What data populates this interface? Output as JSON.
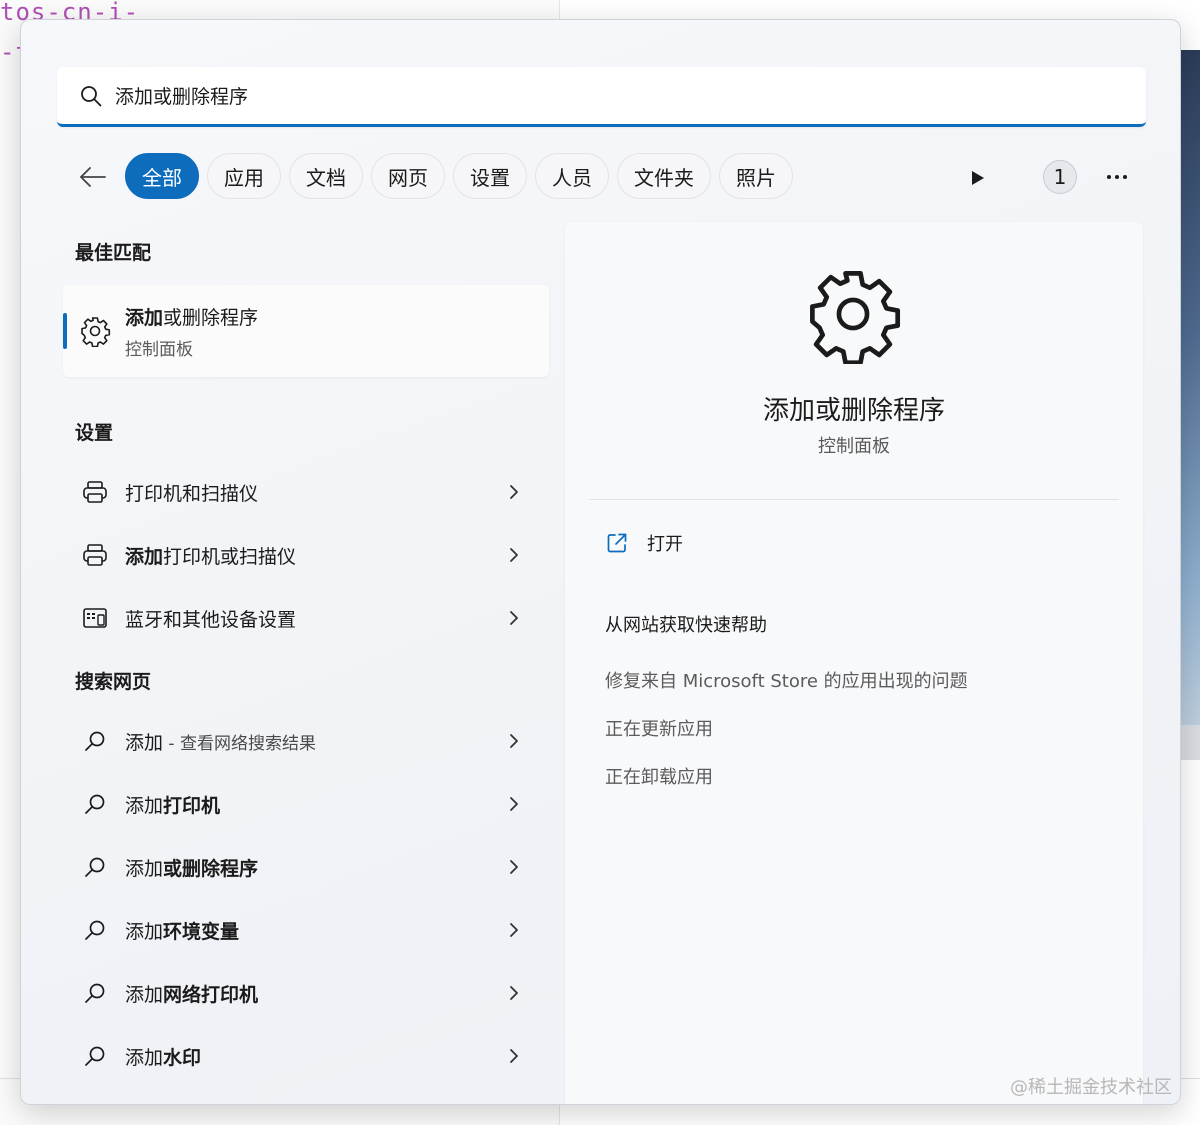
{
  "background": {
    "code_line_1": "tos-cn-i-",
    "code_line_2": "-t"
  },
  "search": {
    "value": "添加或删除程序",
    "placeholder": ""
  },
  "filters": {
    "items": [
      "全部",
      "应用",
      "文档",
      "网页",
      "设置",
      "人员",
      "文件夹",
      "照片"
    ],
    "active_index": 0,
    "count_badge": "1",
    "more_label": "···"
  },
  "results": {
    "best_match_heading": "最佳匹配",
    "best_match": {
      "title_bold": "添加",
      "title_rest": "或删除程序",
      "subtitle": "控制面板"
    },
    "settings_heading": "设置",
    "settings": [
      {
        "bold": "",
        "text": "打印机和扫描仪",
        "icon": "printer-icon"
      },
      {
        "bold": "添加",
        "text": "打印机或扫描仪",
        "icon": "printer-icon"
      },
      {
        "bold": "",
        "text": "蓝牙和其他设备设置",
        "icon": "devices-icon"
      }
    ],
    "web_heading": "搜索网页",
    "web": [
      {
        "prefix": "添加",
        "bold": "",
        "suffix": " - 查看网络搜索结果"
      },
      {
        "prefix": "添加",
        "bold": "打印机",
        "suffix": ""
      },
      {
        "prefix": "添加",
        "bold": "或删除程序",
        "suffix": ""
      },
      {
        "prefix": "添加",
        "bold": "环境变量",
        "suffix": ""
      },
      {
        "prefix": "添加",
        "bold": "网络打印机",
        "suffix": ""
      },
      {
        "prefix": "添加",
        "bold": "水印",
        "suffix": ""
      }
    ]
  },
  "preview": {
    "title": "添加或删除程序",
    "subtitle": "控制面板",
    "actions": {
      "open": "打开",
      "help": "从网站获取快速帮助",
      "fix": "修复来自 Microsoft Store 的应用出现的问题",
      "updating": "正在更新应用",
      "uninstalling": "正在卸载应用"
    }
  },
  "watermark": "@稀土掘金技术社区",
  "colors": {
    "accent": "#0e6cbd",
    "pane": "#f8f9fb"
  }
}
